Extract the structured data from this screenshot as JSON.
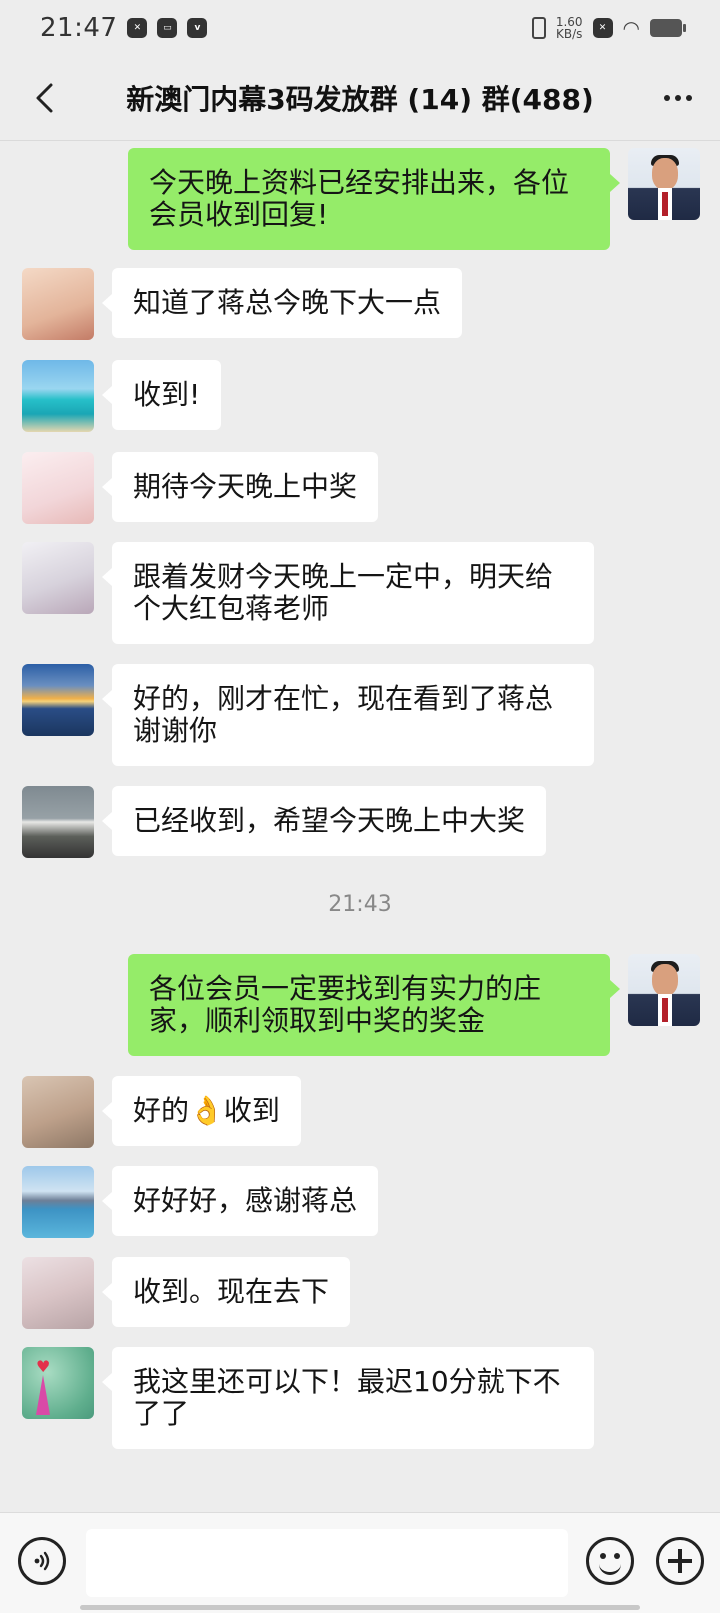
{
  "status_bar": {
    "time": "21:47",
    "net_speed_value": "1.60",
    "net_speed_unit": "KB/s",
    "icons": [
      "capcut-icon",
      "app-icon",
      "vivo-icon",
      "vibrate-icon",
      "close-notification-icon",
      "wifi-icon",
      "battery-icon"
    ]
  },
  "nav": {
    "title": "新澳门内幕3码发放群 (14) 群(488)"
  },
  "messages": [
    {
      "side": "right",
      "text": "今天晚上资料已经安排出来，各位会员收到回复!"
    },
    {
      "side": "left",
      "text": "知道了蒋总今晚下大一点"
    },
    {
      "side": "left",
      "text": "收到!"
    },
    {
      "side": "left",
      "text": "期待今天晚上中奖"
    },
    {
      "side": "left",
      "text": "跟着发财今天晚上一定中，明天给个大红包蒋老师"
    },
    {
      "side": "left",
      "text": "好的，刚才在忙，现在看到了蒋总谢谢你"
    },
    {
      "side": "left",
      "text": "已经收到，希望今天晚上中大奖"
    },
    {
      "side": "right",
      "text": "各位会员一定要找到有实力的庄家，顺利领取到中奖的奖金"
    },
    {
      "side": "left",
      "text": "好的👌收到"
    },
    {
      "side": "left",
      "text": "好好好，感谢蒋总"
    },
    {
      "side": "left",
      "text": "收到。现在去下"
    },
    {
      "side": "left",
      "text": "我这里还可以下！最迟10分就下不了了"
    }
  ],
  "timestamp": "21:43",
  "input_bar": {
    "placeholder": ""
  }
}
